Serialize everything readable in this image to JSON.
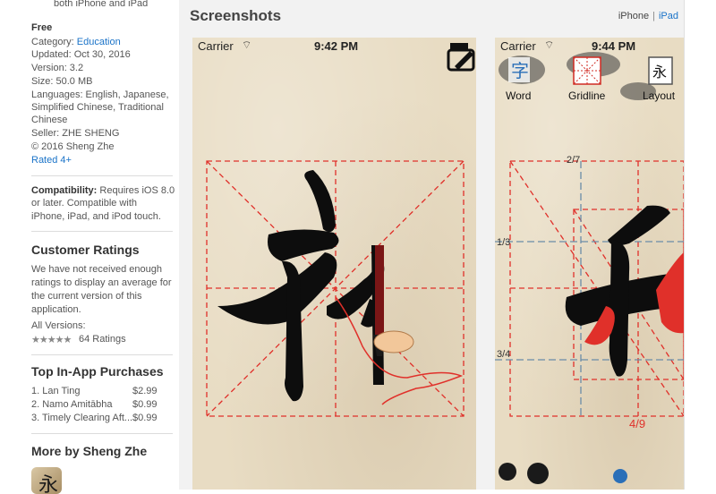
{
  "sidebar": {
    "top_text": "both iPhone and iPad",
    "price": "Free",
    "category_label": "Category:",
    "category_value": "Education",
    "updated": "Updated: Oct 30, 2016",
    "version": "Version: 3.2",
    "size": "Size: 50.0 MB",
    "languages_line1": "Languages: English, Japanese,",
    "languages_line2": "Simplified Chinese, Traditional",
    "languages_line3": "Chinese",
    "seller": "Seller: ZHE SHENG",
    "copyright": "© 2016 Sheng Zhe",
    "rated": "Rated 4+",
    "compat_label": "Compatibility:",
    "compat_line1": " Requires iOS 8.0",
    "compat_line2": "or later. Compatible with",
    "compat_line3": "iPhone, iPad, and iPod touch.",
    "ratings_title": "Customer Ratings",
    "ratings_line1": "We have not received enough",
    "ratings_line2": "ratings to display an average for",
    "ratings_line3": "the current version of this",
    "ratings_line4": "application.",
    "all_versions": "All Versions:",
    "stars": "★★★★★",
    "ratings_count": "64 Ratings",
    "iap_title": "Top In-App Purchases",
    "iap": [
      {
        "name": "1. Lan Ting",
        "price": "$2.99"
      },
      {
        "name": "2. Namo Amitābha",
        "price": "$0.99"
      },
      {
        "name": "3. Timely Clearing Aft...",
        "price": "$0.99"
      }
    ],
    "more_title": "More by Sheng Zhe"
  },
  "main": {
    "title": "Screenshots",
    "device_iphone": "iPhone",
    "device_ipad": "iPad"
  },
  "shot1": {
    "carrier": "Carrier",
    "time": "9:42 PM"
  },
  "shot2": {
    "carrier": "Carrier",
    "time": "9:44 PM",
    "toolbar": [
      "Word",
      "Gridline",
      "Layout"
    ],
    "grid_label_top": "2/7",
    "grid_label_left1": "1/3",
    "grid_label_left2": "3/4",
    "grid_label_bottom": "4/9"
  },
  "colors": {
    "link": "#1a73c8",
    "grid_red": "#e0302a",
    "grid_blue": "#6a8ca8",
    "ink": "#0d0d0d"
  }
}
